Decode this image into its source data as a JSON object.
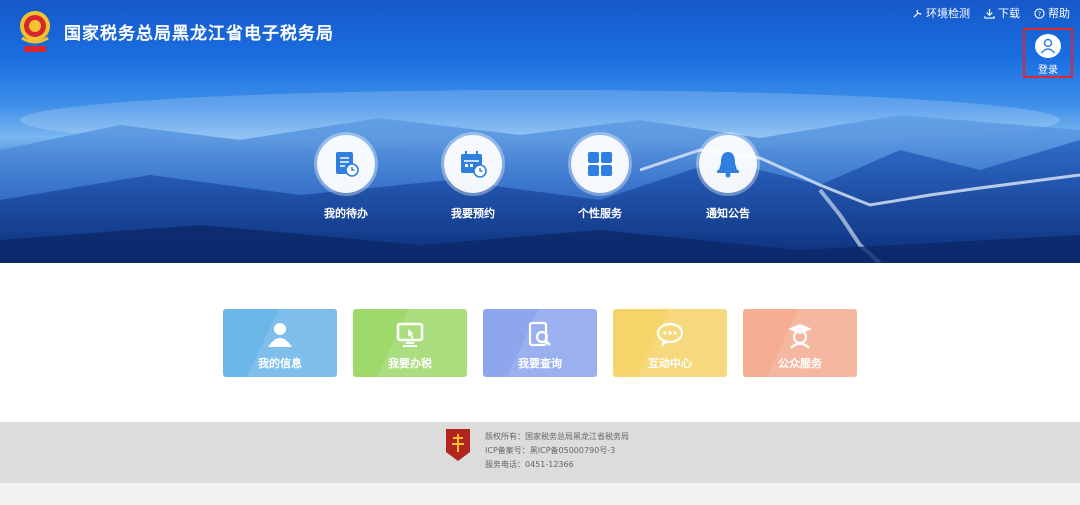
{
  "header": {
    "site_title": "国家税务总局黑龙江省电子税务局",
    "nav": [
      {
        "label": "环境检测",
        "icon": "tools-icon"
      },
      {
        "label": "下载",
        "icon": "download-icon"
      },
      {
        "label": "帮助",
        "icon": "help-icon"
      }
    ],
    "login_label": "登录"
  },
  "hero_items": [
    {
      "label": "我的待办",
      "icon": "todo-document-icon"
    },
    {
      "label": "我要预约",
      "icon": "calendar-clock-icon"
    },
    {
      "label": "个性服务",
      "icon": "grid-icon"
    },
    {
      "label": "通知公告",
      "icon": "bell-icon"
    }
  ],
  "cards": [
    {
      "label": "我的信息",
      "icon": "user-icon",
      "color": "#6bb7e8"
    },
    {
      "label": "我要办税",
      "icon": "monitor-cursor-icon",
      "color": "#9fd96b"
    },
    {
      "label": "我要查询",
      "icon": "search-document-icon",
      "color": "#8ea6ec"
    },
    {
      "label": "互动中心",
      "icon": "chat-bubble-icon",
      "color": "#f5d46a"
    },
    {
      "label": "公众服务",
      "icon": "graduate-icon",
      "color": "#f5ae93"
    }
  ],
  "footer": {
    "copyright": "版权所有：国家税务总局黑龙江省税务局",
    "icp": "ICP备案号：黑ICP备05000790号-3",
    "phone": "服务电话：0451-12366"
  },
  "colors": {
    "login_border": "#e0272b",
    "hero_icon": "#2f7fe0"
  }
}
